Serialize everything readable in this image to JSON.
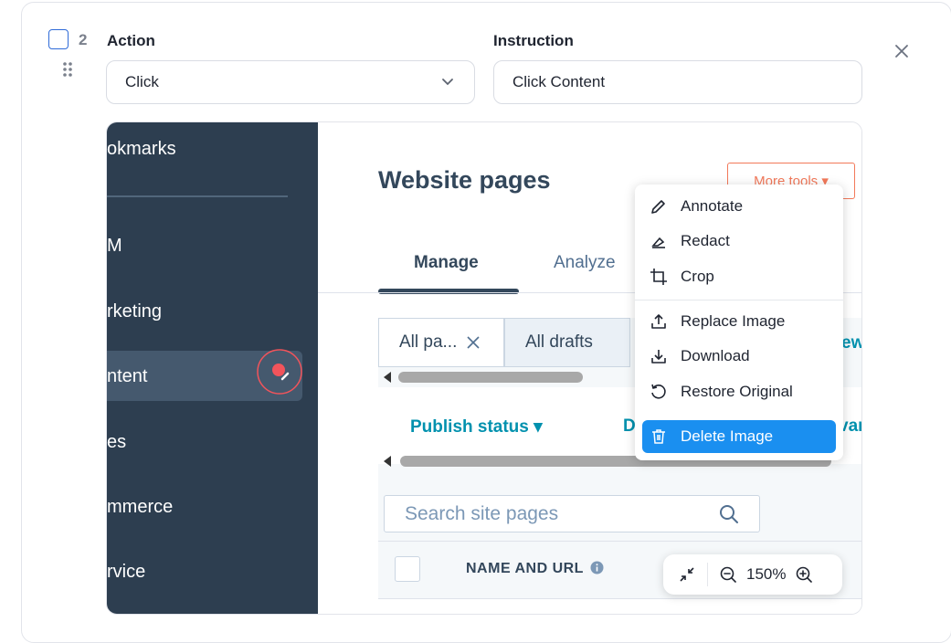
{
  "step": {
    "number": "2"
  },
  "action": {
    "label": "Action",
    "value": "Click"
  },
  "instruction": {
    "label": "Instruction",
    "value": "Click Content"
  },
  "screenshot": {
    "sidebar": {
      "items": [
        "okmarks",
        "M",
        "rketing",
        "ntent",
        "es",
        "mmerce",
        "rvice"
      ],
      "active_index": 3
    },
    "page_title": "Website pages",
    "more_tools": "More tools ▾",
    "tabs": [
      "Manage",
      "Analyze"
    ],
    "filter_tabs": [
      "All pa...",
      "All drafts"
    ],
    "view_link": "ew",
    "filters": {
      "publish_status": "Publish status ▾",
      "d_label": "D",
      "var_label": "var"
    },
    "search_placeholder": "Search site pages",
    "table_header": "NAME AND URL"
  },
  "image_menu": {
    "items": [
      {
        "label": "Annotate",
        "icon": "pencil-icon"
      },
      {
        "label": "Redact",
        "icon": "redact-icon"
      },
      {
        "label": "Crop",
        "icon": "crop-icon"
      },
      {
        "label": "Replace Image",
        "icon": "upload-icon"
      },
      {
        "label": "Download",
        "icon": "download-icon"
      },
      {
        "label": "Restore Original",
        "icon": "restore-icon"
      },
      {
        "label": "Delete Image",
        "icon": "trash-icon"
      }
    ]
  },
  "zoom": {
    "level": "150%"
  },
  "colors": {
    "accent": "#2f6bd8",
    "sidebar": "#2d3e50",
    "teal": "#0091ae",
    "delete": "#1a8ff0",
    "marker": "#f2545b"
  }
}
